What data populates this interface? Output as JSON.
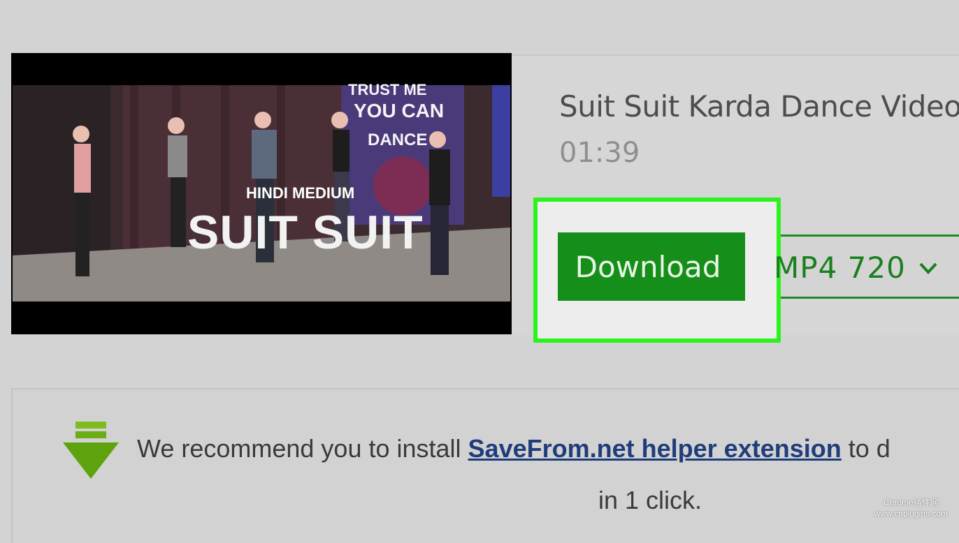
{
  "video": {
    "title": "Suit Suit Karda Dance Video -",
    "duration": "01:39",
    "thumbnail": {
      "overlay_small": "HINDI MEDIUM",
      "overlay_big": "SUIT SUIT",
      "poster_text_1": "TRUST ME",
      "poster_text_2": "YOU CAN",
      "poster_text_3": "DANCE"
    }
  },
  "download": {
    "button_label": "Download",
    "format_label": "MP4  720",
    "chevron_icon": "chevron-down-icon"
  },
  "recommendation": {
    "text_before": "We recommend you to install ",
    "link_text": "SaveFrom.net helper extension",
    "text_after": " to d",
    "line2": "in 1 click.",
    "icon": "download-arrow-icon"
  },
  "watermark": {
    "line1": "Chrome插件网",
    "line2": "www.cnplugins.com"
  },
  "colors": {
    "highlight": "#2cf21d",
    "download_green": "#168f1a",
    "link_blue": "#1f3d7a"
  }
}
